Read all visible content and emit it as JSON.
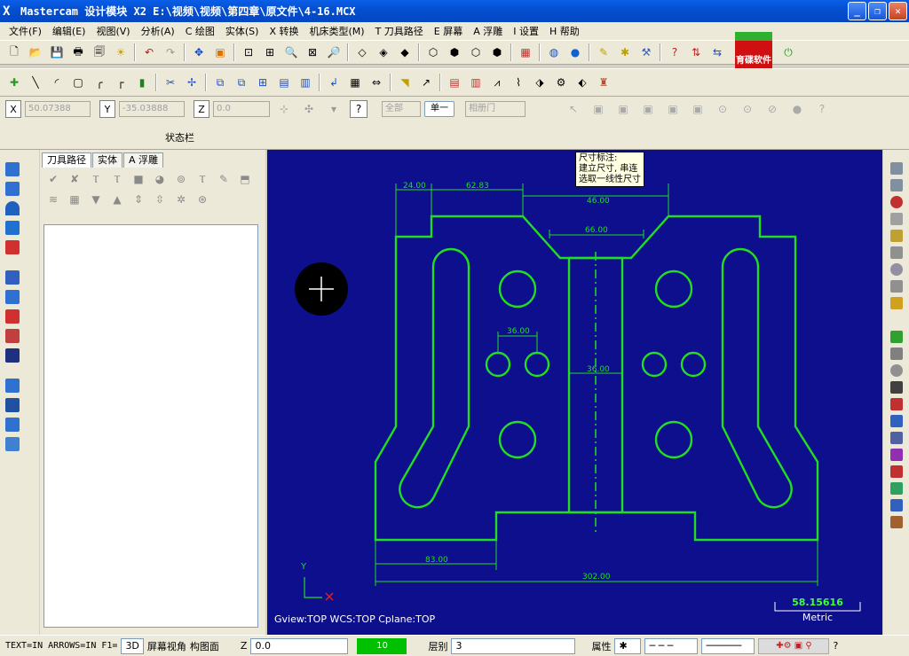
{
  "window": {
    "title": "Mastercam 设计模块  X2  E:\\视频\\视频\\第四章\\原文件\\4-16.MCX"
  },
  "menu": [
    "文件(F)",
    "编辑(E)",
    "视图(V)",
    "分析(A)",
    "C 绘图",
    "实体(S)",
    "X 转换",
    "机床类型(M)",
    "T 刀具路径",
    "E 屏幕",
    "A 浮雕",
    "I 设置",
    "H 帮助"
  ],
  "logo": {
    "text": "育碟软件"
  },
  "coords": {
    "x_label": "X",
    "x_value": "50.07388",
    "y_label": "Y",
    "y_value": "-35.03888",
    "z_label": "Z",
    "z_value": "0.0",
    "mode": "全部",
    "single": "单一",
    "type_select": "相册门"
  },
  "statusbar": {
    "label": "状态栏"
  },
  "panel": {
    "tabs": [
      "刀具路径",
      "实体",
      "A 浮雕"
    ]
  },
  "viewport": {
    "tooltip": [
      "尺寸标注:",
      "建立尺寸, 串连",
      "选取一线性尺寸"
    ],
    "axis_y": "Y",
    "view_info": "Gview:TOP   WCS:TOP   Cplane:TOP",
    "scale_value": "58.15616",
    "scale_unit": "Metric",
    "dimensions": {
      "d1": "24.00",
      "d2": "62.83",
      "d3": "46.00",
      "d4": "66.00",
      "d5": "36.00",
      "d6": "36.00",
      "d7": "83.00",
      "d8": "302.00"
    },
    "accent": "#22dd22",
    "background": "#0d0f8c"
  },
  "bottom": {
    "mode_text": "TEXT=IN ARROWS=IN F1=",
    "view3d": "3D",
    "screen_view": "屏幕视角",
    "plane": "构图面",
    "z_label": "Z",
    "z_value": "0.0",
    "color_value": "10",
    "layer_label": "层别",
    "layer_value": "3",
    "attr_label": "属性"
  }
}
